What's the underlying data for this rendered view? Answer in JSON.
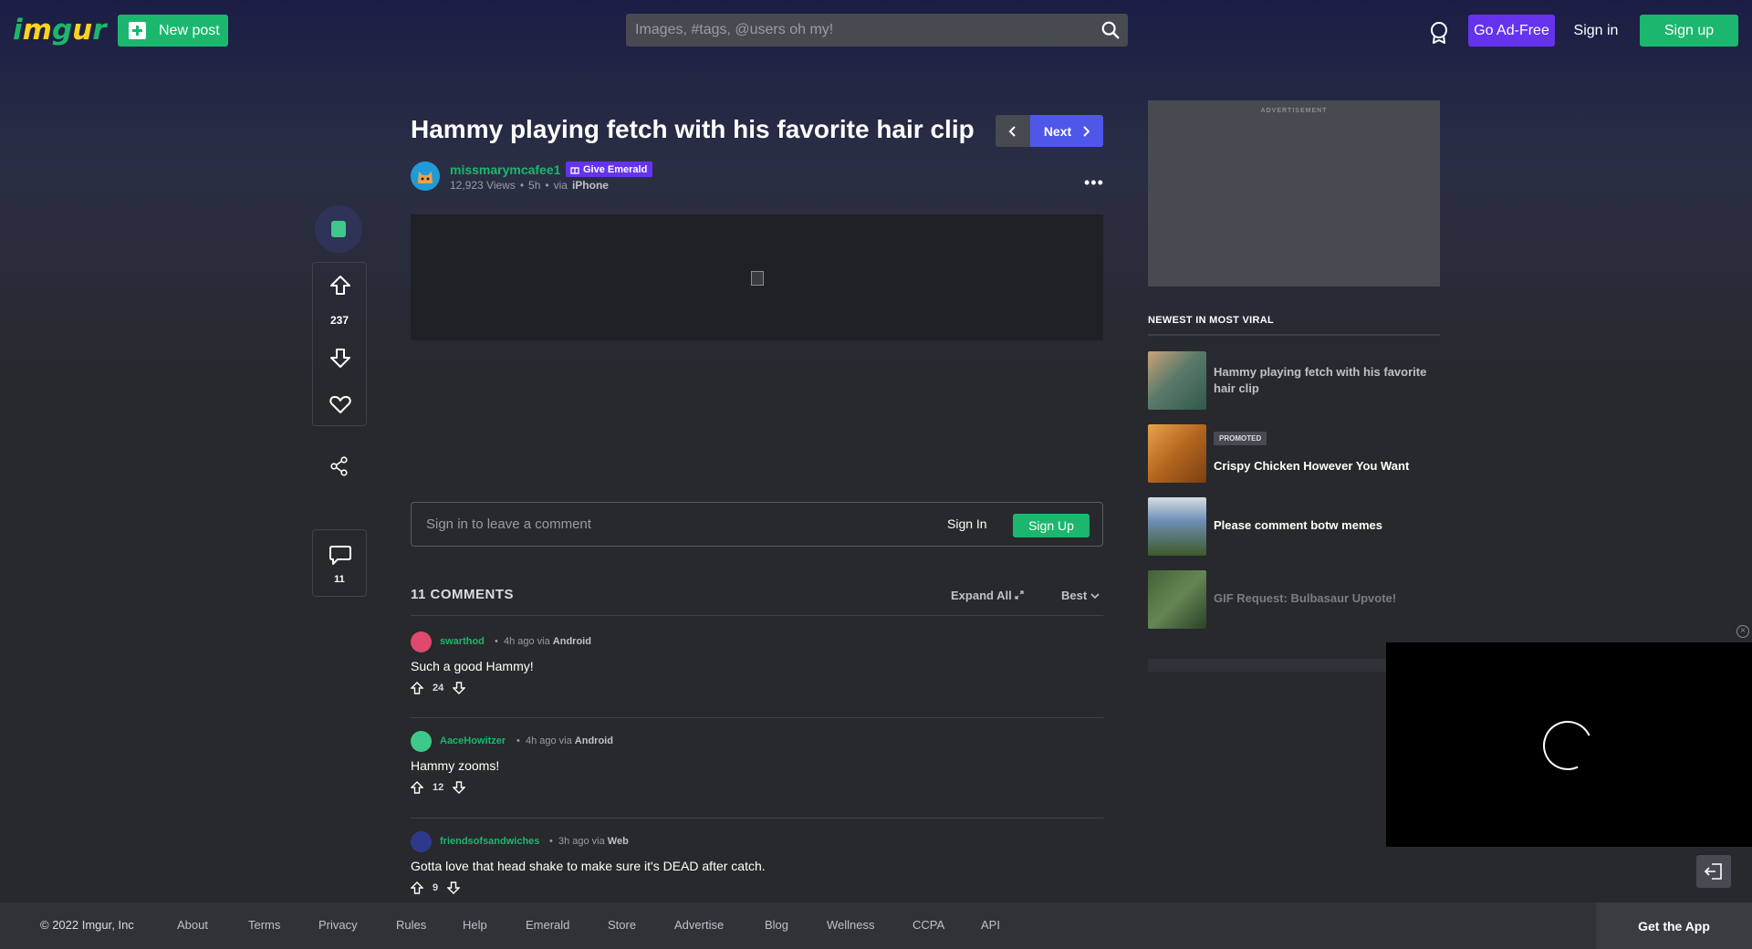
{
  "header": {
    "logo": "imgur",
    "new_post_label": "New post",
    "search_placeholder": "Images, #tags, @users oh my!",
    "go_adfree_label": "Go Ad-Free",
    "signin_label": "Sign in",
    "signup_label": "Sign up"
  },
  "post": {
    "title": "Hammy playing fetch with his favorite hair clip",
    "next_label": "Next",
    "author": "missmarymcafee1",
    "give_emerald_label": "Give Emerald",
    "views": "12,923 Views",
    "time": "5h",
    "via_prefix": "via",
    "via": "iPhone",
    "more_label": "•••"
  },
  "rail": {
    "vote_count": "237",
    "comment_count": "11"
  },
  "comment_entry": {
    "placeholder": "Sign in to leave a comment",
    "signin_label": "Sign In",
    "signup_label": "Sign Up"
  },
  "comments": {
    "heading": "11 COMMENTS",
    "expand_all_label": "Expand All",
    "sort_label": "Best",
    "items": [
      {
        "user": "swarthod",
        "time": "4h ago via",
        "platform": "Android",
        "text": "Such a good Hammy!",
        "score": "24",
        "avatar_color": "#e0496b"
      },
      {
        "user": "AaceHowitzer",
        "time": "4h ago via",
        "platform": "Android",
        "text": "Hammy zooms!",
        "score": "12",
        "avatar_color": "#3ec98a"
      },
      {
        "user": "friendsofsandwiches",
        "time": "3h ago via",
        "platform": "Web",
        "text": "Gotta love that head shake to make sure it's DEAD after catch.",
        "score": "9",
        "avatar_color": "#2d3a8c"
      }
    ]
  },
  "sidebar": {
    "ad_label": "ADVERTISEMENT",
    "viral_heading": "NEWEST IN MOST VIRAL",
    "items": [
      {
        "title": "Hammy playing fetch with his favorite hair clip",
        "promoted": ""
      },
      {
        "title": "Crispy Chicken However You Want",
        "promoted": "PROMOTED"
      },
      {
        "title": "Please comment botw memes",
        "promoted": ""
      },
      {
        "title": "GIF Request: Bulbasaur Upvote!",
        "promoted": ""
      }
    ]
  },
  "footer": {
    "copyright": "© 2022 Imgur, Inc",
    "links": [
      "About",
      "Terms",
      "Privacy",
      "Rules",
      "Help",
      "Emerald",
      "Store",
      "Advertise",
      "Blog",
      "Wellness",
      "CCPA",
      "API"
    ],
    "get_app_label": "Get the App"
  },
  "colors": {
    "accent_green": "#1bb76e",
    "accent_purple": "#6533ed",
    "accent_blue": "#4e57ea",
    "background": "#27292d"
  },
  "icons": [
    "plus-icon",
    "search-icon",
    "medal-icon",
    "chevron-left-icon",
    "chevron-right-icon",
    "more-icon",
    "emerald-icon",
    "upvote-icon",
    "downvote-icon",
    "heart-icon",
    "share-icon",
    "comment-icon",
    "expand-icon",
    "chevron-down-icon",
    "close-icon",
    "exit-icon",
    "gift-icon"
  ]
}
